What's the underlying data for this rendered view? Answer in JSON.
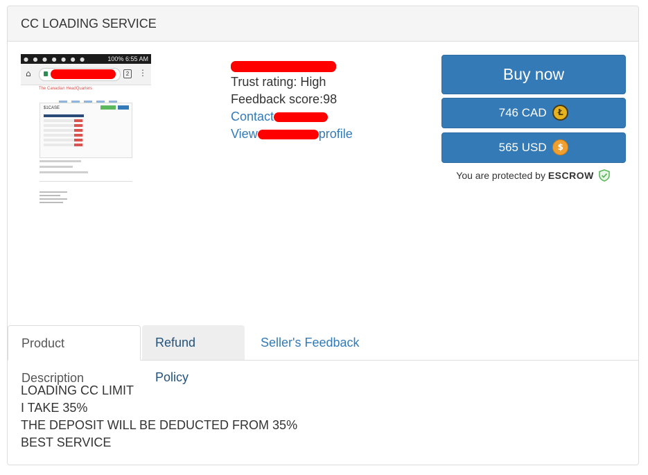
{
  "panel": {
    "title": "CC LOADING SERVICE"
  },
  "thumbnail": {
    "status_time": "6:55 AM",
    "status_battery": "100%",
    "tab_count": "2",
    "site_title": "The Canadian HeadQuarters",
    "box_title": "$1CASE"
  },
  "seller": {
    "trust_rating": "Trust rating: High",
    "feedback_score": "Feedback score:98",
    "contact_prefix": "Contact",
    "view_prefix": "View",
    "view_suffix": "profile"
  },
  "purchase": {
    "buy_now": "Buy now",
    "price_cad": "746 CAD",
    "price_usd": "565 USD",
    "escrow_prefix": "You are protected by",
    "escrow_word": "ESCROW"
  },
  "tabs": [
    {
      "label": "Product Description",
      "active": true
    },
    {
      "label": "Refund Policy",
      "active": false
    },
    {
      "label": "Seller's Feedback",
      "active": false
    }
  ],
  "description": [
    "LOADING CC LIMIT",
    "I TAKE 35%",
    "THE DEPOSIT WILL BE DEDUCTED FROM 35%",
    "BEST SERVICE"
  ],
  "colors": {
    "primary": "#337ab7",
    "redaction": "#ff0000",
    "heading_bg": "#f5f5f5",
    "litecoin": "#e6b31e",
    "dollar_coin": "#f0a030",
    "escrow_shield": "#5cb85c"
  },
  "icons": {
    "cad_coin": "litecoin-icon",
    "usd_coin": "dollar-coin-icon",
    "escrow": "shield-check-icon"
  }
}
